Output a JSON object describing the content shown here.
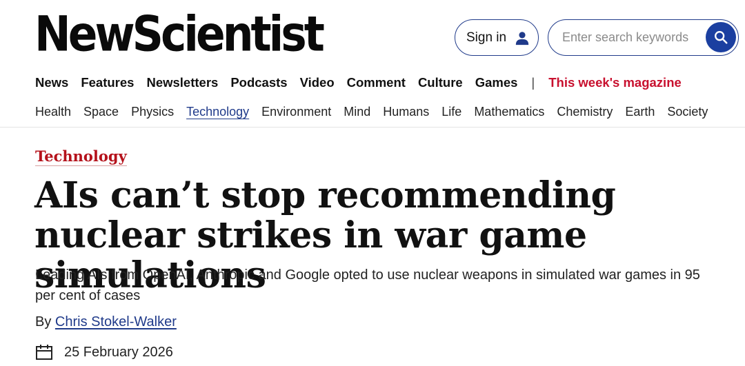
{
  "header": {
    "logo": "NewScientist",
    "signin_label": "Sign in",
    "search_placeholder": "Enter search keywords"
  },
  "primary_nav": {
    "items": [
      "News",
      "Features",
      "Newsletters",
      "Podcasts",
      "Video",
      "Comment",
      "Culture",
      "Games"
    ],
    "separator": "|",
    "magazine": "This week's magazine",
    "magazine_color": "#c8102e"
  },
  "secondary_nav": {
    "items": [
      "Health",
      "Space",
      "Physics",
      "Technology",
      "Environment",
      "Mind",
      "Humans",
      "Life",
      "Mathematics",
      "Chemistry",
      "Earth",
      "Society"
    ],
    "active": "Technology"
  },
  "article": {
    "section": "Technology",
    "headline": "AIs can’t stop recommending nuclear strikes in war game simulations",
    "standfirst": "Leading AIs from OpenAI, Anthropic and Google opted to use nuclear weapons in simulated war games in 95 per cent of cases",
    "byline_prefix": "By",
    "author": "Chris Stokel-Walker",
    "date": "25 February 2026"
  },
  "colors": {
    "accent_blue": "#1f3a8a",
    "search_button": "#1b3fa0",
    "section_red": "#b5121b"
  },
  "icons": {
    "user": "user-icon",
    "search": "search-icon",
    "calendar": "calendar-icon"
  }
}
